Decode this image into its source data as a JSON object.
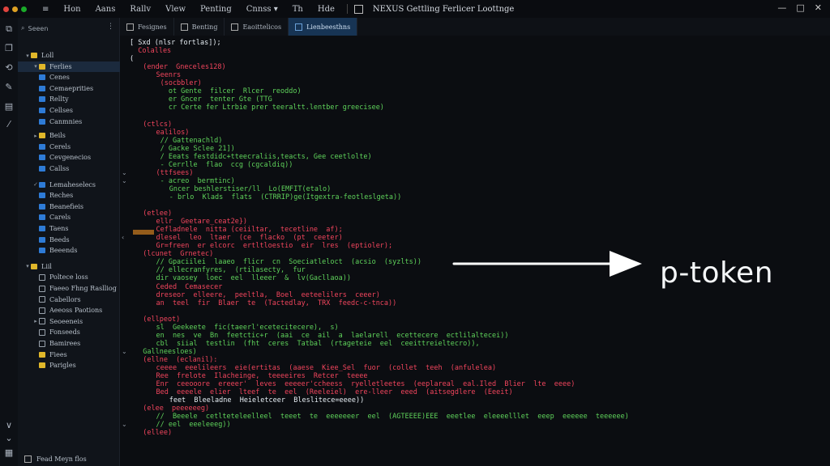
{
  "titlebar": {
    "menu": [
      "≡",
      "Hon",
      "Aans",
      "Rallv",
      "Vlew",
      "Penting",
      "Cnnss ▾",
      "Th",
      "Hde"
    ],
    "window_title": "NEXUS Gettling Ferlicer Loottnge",
    "controls": [
      "—",
      "□",
      "✕"
    ]
  },
  "sidebar": {
    "search_label": "Seeen",
    "items": [
      {
        "label": "Loll",
        "kind": "folder",
        "chev": "▾",
        "indent": 0,
        "selected": false
      },
      {
        "label": "Ferlies",
        "kind": "folder",
        "chev": "▾",
        "indent": 1,
        "selected": true
      },
      {
        "label": "Cenes",
        "kind": "file",
        "chev": "",
        "indent": 1,
        "selected": false
      },
      {
        "label": "Cemaeprities",
        "kind": "file",
        "chev": "",
        "indent": 1,
        "selected": false
      },
      {
        "label": "Rellty",
        "kind": "file",
        "chev": "",
        "indent": 1,
        "selected": false
      },
      {
        "label": "Cellses",
        "kind": "file",
        "chev": "",
        "indent": 1,
        "selected": false
      },
      {
        "label": "Canmnies",
        "kind": "file",
        "chev": "",
        "indent": 1,
        "selected": false
      },
      {
        "label": "Beils",
        "kind": "folder",
        "chev": "▸",
        "indent": 1,
        "selected": false
      },
      {
        "label": "Cerels",
        "kind": "file",
        "chev": "",
        "indent": 1,
        "selected": false
      },
      {
        "label": "Cevgenecios",
        "kind": "file",
        "chev": "",
        "indent": 1,
        "selected": false
      },
      {
        "label": "Callss",
        "kind": "file",
        "chev": "",
        "indent": 1,
        "selected": false
      },
      {
        "label": "Lemaheselecs",
        "kind": "file",
        "chev": "✓",
        "indent": 1,
        "selected": false
      },
      {
        "label": "Reches",
        "kind": "file",
        "chev": "",
        "indent": 1,
        "selected": false
      },
      {
        "label": "Beanefieis",
        "kind": "file",
        "chev": "",
        "indent": 1,
        "selected": false
      },
      {
        "label": "Carels",
        "kind": "file",
        "chev": "",
        "indent": 1,
        "selected": false
      },
      {
        "label": "Taens",
        "kind": "file",
        "chev": "",
        "indent": 1,
        "selected": false
      },
      {
        "label": "Beeds",
        "kind": "file",
        "chev": "",
        "indent": 1,
        "selected": false
      },
      {
        "label": "Beeends",
        "kind": "file",
        "chev": "",
        "indent": 1,
        "selected": false
      },
      {
        "label": "Liil",
        "kind": "folder",
        "chev": "▾",
        "indent": 0,
        "selected": false
      },
      {
        "label": "Poltece loss",
        "kind": "outline",
        "chev": "",
        "indent": 1,
        "selected": false
      },
      {
        "label": "Faeeo Fhng Raslliog",
        "kind": "outline",
        "chev": "",
        "indent": 1,
        "selected": false
      },
      {
        "label": "Cabellors",
        "kind": "outline",
        "chev": "",
        "indent": 1,
        "selected": false
      },
      {
        "label": "Aeeoss Paotions",
        "kind": "outline",
        "chev": "",
        "indent": 1,
        "selected": false
      },
      {
        "label": "Seoeeneis",
        "kind": "outline",
        "chev": "▸",
        "indent": 1,
        "selected": false
      },
      {
        "label": "Fonseeds",
        "kind": "outline",
        "chev": "",
        "indent": 1,
        "selected": false
      },
      {
        "label": "Bamirees",
        "kind": "outline",
        "chev": "",
        "indent": 1,
        "selected": false
      },
      {
        "label": "Fiees",
        "kind": "folder",
        "chev": "",
        "indent": 1,
        "selected": false
      },
      {
        "label": "Parigles",
        "kind": "folder",
        "chev": "",
        "indent": 1,
        "selected": false
      }
    ],
    "footer_label": "Fead Meyn flos"
  },
  "tabs": [
    {
      "label": "Fesignes",
      "active": false
    },
    {
      "label": "Benting",
      "active": false
    },
    {
      "label": "Eaoittelicos",
      "active": false
    },
    {
      "label": "Lienbeesthns",
      "active": true
    }
  ],
  "code": [
    {
      "t": "[ Sxd (nlsr fortlas]);",
      "c": "w",
      "i": 0
    },
    {
      "t": "  Colalles",
      "c": "r",
      "i": 0
    },
    {
      "t": "(",
      "c": "w",
      "i": 0
    },
    {
      "t": "  (ender  Gneceles128)",
      "c": "r",
      "i": 1
    },
    {
      "t": "    Seenrs",
      "c": "r",
      "i": 2
    },
    {
      "t": "     (socbbler)",
      "c": "r",
      "i": 2
    },
    {
      "t": "       ot Gente  filcer  Rlcer  reoddo)",
      "c": "g",
      "i": 2
    },
    {
      "t": "       er Gncer  tenter Gte (TTG",
      "c": "g",
      "i": 2
    },
    {
      "t": "       cr Certe fer Ltrbie prer teeraltt.lentber greecisee)",
      "c": "g",
      "i": 2
    },
    {
      "t": "",
      "c": "w",
      "i": 0
    },
    {
      "t": "  (ctlcs)",
      "c": "r",
      "i": 1
    },
    {
      "t": "    ealilos)",
      "c": "r",
      "i": 2
    },
    {
      "t": "     // Gattenachld)",
      "c": "g",
      "i": 2
    },
    {
      "t": "     / Gacke Sclee 21])",
      "c": "g",
      "i": 2
    },
    {
      "t": "     / Eeats festdidc+tteecraliis,teacts, Gee ceetlolte)",
      "c": "g",
      "i": 2
    },
    {
      "t": "     - Cerrlle  flao  ccg (cgcaldiq))",
      "c": "g",
      "i": 2
    },
    {
      "t": "    (ttfsees)",
      "c": "r",
      "i": 2
    },
    {
      "t": "     - acreo  bermtinc)",
      "c": "g",
      "i": 2
    },
    {
      "t": "      Gncer beshlerstiser/ll  Lo(EMFIT(etalo)",
      "c": "g",
      "i": 3
    },
    {
      "t": "      - brlo  Klads  flats  (CTRRIP)ge(Itgextra-feotleslgeta))",
      "c": "g",
      "i": 3
    },
    {
      "t": "",
      "c": "w",
      "i": 0
    },
    {
      "t": "  (etlee)",
      "c": "r",
      "i": 1
    },
    {
      "t": "    ellr  Geetare_ceat2e})",
      "c": "r",
      "i": 2
    },
    {
      "t": "    Cefladnele  nitta (ceiiltar,  tecetline  af);",
      "c": "r",
      "i": 2
    },
    {
      "t": "    dlesel  leo  ltaer  (ce  flacko  (pt  ceeter)",
      "c": "r",
      "i": 2
    },
    {
      "t": "    Gr=freen  er elcorc  ertltloestio  eir  lres  (eptioler);",
      "c": "r",
      "i": 2
    },
    {
      "t": "  (lcunet  Grnetec)",
      "c": "r",
      "i": 1
    },
    {
      "t": "    // Gpaciilei  laaeo  flicr  cn  Soeciatleloct  (acsio  (syzlts))",
      "c": "g",
      "i": 2
    },
    {
      "t": "    // ellecranfyres,  (rtilasecty,  fur",
      "c": "g",
      "i": 2
    },
    {
      "t": "    dir vaosey  loec  eel  lleeer  &  lv(Gacllaoa))",
      "c": "g",
      "i": 2
    },
    {
      "t": "    Ceded  Cemasecer",
      "c": "r",
      "i": 2
    },
    {
      "t": "    dreseor  elleere,  peeltla,  Boel  eeteelilers  ceeer)",
      "c": "r",
      "i": 2
    },
    {
      "t": "    an  teel  fir  Blaer  te  (Tactedlay,  TRX  feedc-c-tnca))",
      "c": "r",
      "i": 2
    },
    {
      "t": "",
      "c": "w",
      "i": 0
    },
    {
      "t": "  (ellpeot)",
      "c": "r",
      "i": 1
    },
    {
      "t": "    sl  Geekeete  fic(taeerl'ecetecitecere),  s)",
      "c": "g",
      "i": 2
    },
    {
      "t": "    en  nes  ve  Bn  feetctic+r  (aai  ce  ail  a  laelarell  ecettecere  ectlilaltecei))",
      "c": "g",
      "i": 2
    },
    {
      "t": "    cbl  siial  testlin  (fht  ceres  Tatbal  (rtageteie  eel  ceeittreieltecro)),",
      "c": "g",
      "i": 2
    },
    {
      "t": "  Gallneesloes)",
      "c": "g",
      "i": 1
    },
    {
      "t": "  (ellne  (eclanil):",
      "c": "r",
      "i": 1
    },
    {
      "t": "    ceeee  eeelileers  eie(ertitas  (aaese  Kiee_Sel  fuor  (collet  teeh  (anfulelea)",
      "c": "r",
      "i": 2
    },
    {
      "t": "    Ree  frelote  Ilacheinge,  teeeeires  Retcer  teeee",
      "c": "r",
      "i": 2
    },
    {
      "t": "    Enr  ceeooore  ereeer'  leves  eeeeer'ccheess  ryelletleetes  (eeplareal  eal.Iled  Blier  lte  eeee)",
      "c": "r",
      "i": 2
    },
    {
      "t": "    Bed  eeeele  elier  lteef  te  eel  (Reeleiel)  ere-lleer  eeed  (aitsegdlere  (Eeeit)",
      "c": "r",
      "i": 2
    },
    {
      "t": "      feet  Bleeladne  Heieletceer  Bleslitece=eeee))",
      "c": "w",
      "i": 3
    },
    {
      "t": "  (elee  peeeeeeg)",
      "c": "r",
      "i": 1
    },
    {
      "t": "    //  Beeele  cetlteteleelleel  teeet  te  eeeeeeer  eel  (AGTEEEE)EEE  eeetlee  eleeeelllet  eeep  eeeeee  teeeeee)",
      "c": "g",
      "i": 2
    },
    {
      "t": "    // eel  eeeleeeg))",
      "c": "g",
      "i": 2
    },
    {
      "t": "  (ellee)",
      "c": "r",
      "i": 1
    }
  ],
  "annotation": "p-token",
  "colors": {
    "accent_tab": "#173454",
    "selected_item": "#1b2a3d",
    "code_red": "#f2455d",
    "code_green": "#5fd35b",
    "highlight": "#b6701e"
  }
}
